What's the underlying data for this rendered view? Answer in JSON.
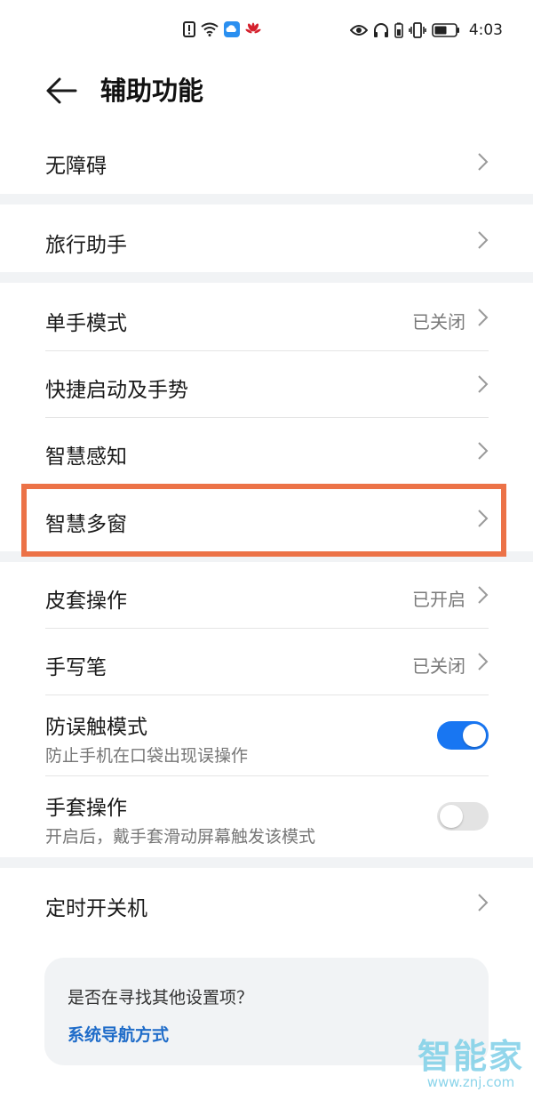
{
  "status_bar": {
    "time": "4:03",
    "icons_left": [
      "alert-icon",
      "wifi-icon",
      "cloud-icon",
      "huawei-logo-icon"
    ],
    "icons_right": [
      "eye-icon",
      "headphones-icon",
      "battery-saver-icon",
      "vibrate-icon",
      "battery-icon"
    ]
  },
  "header": {
    "title": "辅助功能"
  },
  "items": {
    "accessibility": {
      "label": "无障碍"
    },
    "travel_assistant": {
      "label": "旅行助手"
    },
    "one_hand_mode": {
      "label": "单手模式",
      "value": "已关闭"
    },
    "shortcuts_gestures": {
      "label": "快捷启动及手势"
    },
    "smart_sense": {
      "label": "智慧感知"
    },
    "smart_multiwindow": {
      "label": "智慧多窗"
    },
    "cover_operation": {
      "label": "皮套操作",
      "value": "已开启"
    },
    "stylus": {
      "label": "手写笔",
      "value": "已关闭"
    },
    "accidental_touch": {
      "label": "防误触模式",
      "sub": "防止手机在口袋出现误操作",
      "enabled": true
    },
    "glove_mode": {
      "label": "手套操作",
      "sub": "开启后，戴手套滑动屏幕触发该模式",
      "enabled": false
    },
    "scheduled_power": {
      "label": "定时开关机"
    }
  },
  "suggestion": {
    "question": "是否在寻找其他设置项？",
    "link": "系统导航方式"
  },
  "watermark": {
    "main": "智能家",
    "url": "www.znj.com"
  },
  "colors": {
    "accent": "#1876f2",
    "highlight": "#ec7247",
    "link": "#1f6cc9",
    "section_gap": "#f1f3f5"
  }
}
